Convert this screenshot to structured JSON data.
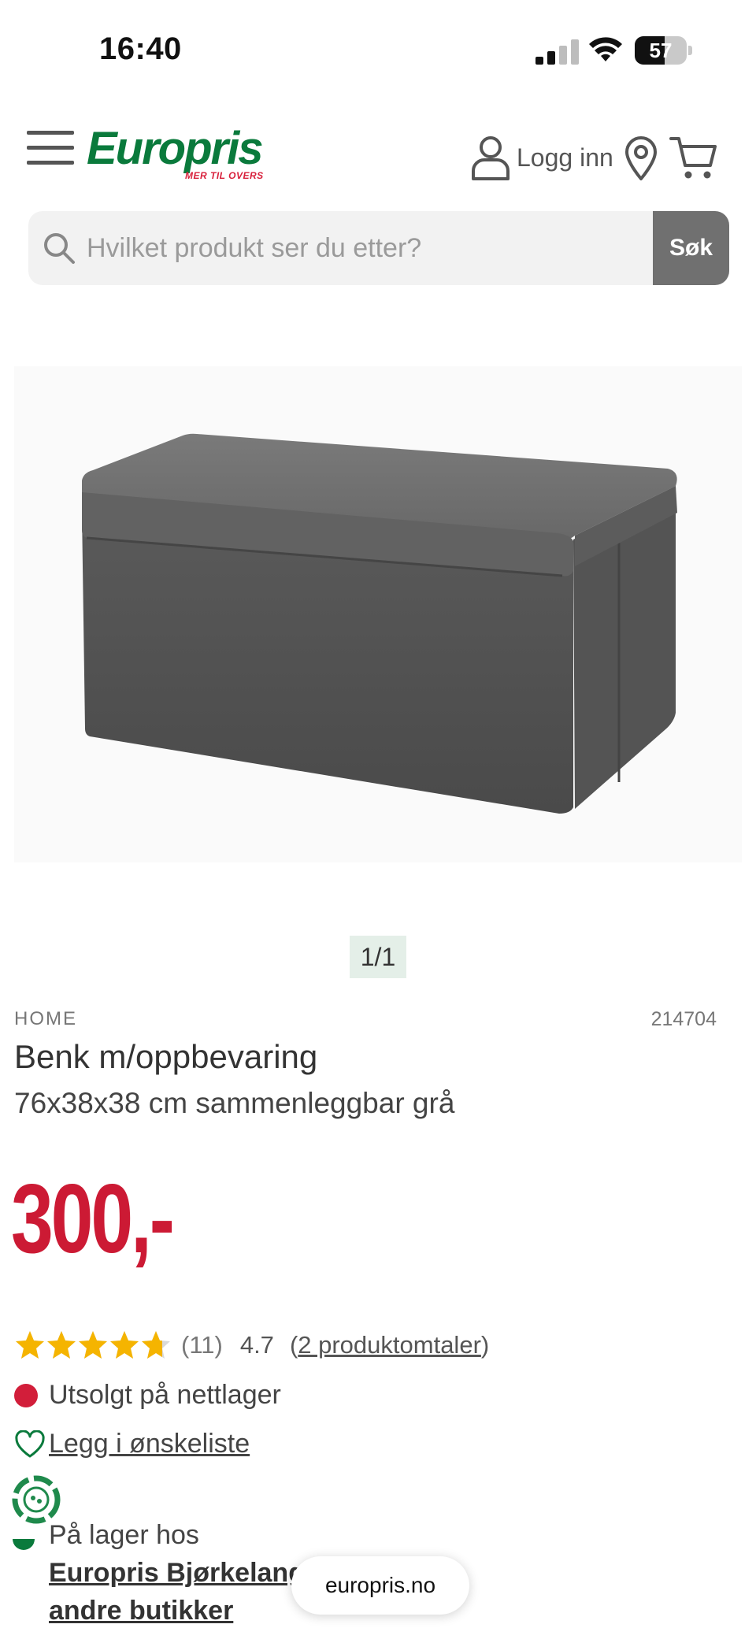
{
  "status_bar": {
    "time": "16:40",
    "battery_level": "57",
    "battery_fraction": 0.57,
    "icons": [
      "signal-icon",
      "wifi-icon",
      "battery-icon"
    ]
  },
  "header": {
    "logo_text": "Europris",
    "logo_tagline": "MER TIL OVERS",
    "login_label": "Logg inn",
    "icons": [
      "menu-icon",
      "user-icon",
      "location-icon",
      "cart-icon"
    ]
  },
  "search": {
    "placeholder": "Hvilket produkt ser du etter?",
    "value": "",
    "button_label": "Søk"
  },
  "gallery": {
    "pager": "1/1"
  },
  "product": {
    "brand": "HOME",
    "sku": "214704",
    "title": "Benk m/oppbevaring",
    "subtitle": "76x38x38 cm sammenleggbar grå",
    "price": "300,-",
    "rating_count": "(11)",
    "rating_value": "4.7",
    "rating_stars": 4.7,
    "reviews_link": "2 produktomtaler",
    "stock_online": "Utsolgt på nettlager",
    "wishlist_label": "Legg i ønskeliste",
    "store_label": "På lager hos",
    "store_name": "Europris Bjørkelangen",
    "other_stores": "andre butikker"
  },
  "browser": {
    "url": "europris.no"
  },
  "colors": {
    "brand_green": "#0a7a3c",
    "price_red": "#cc1a34",
    "star_yellow": "#f5b400",
    "search_button": "#707070"
  }
}
